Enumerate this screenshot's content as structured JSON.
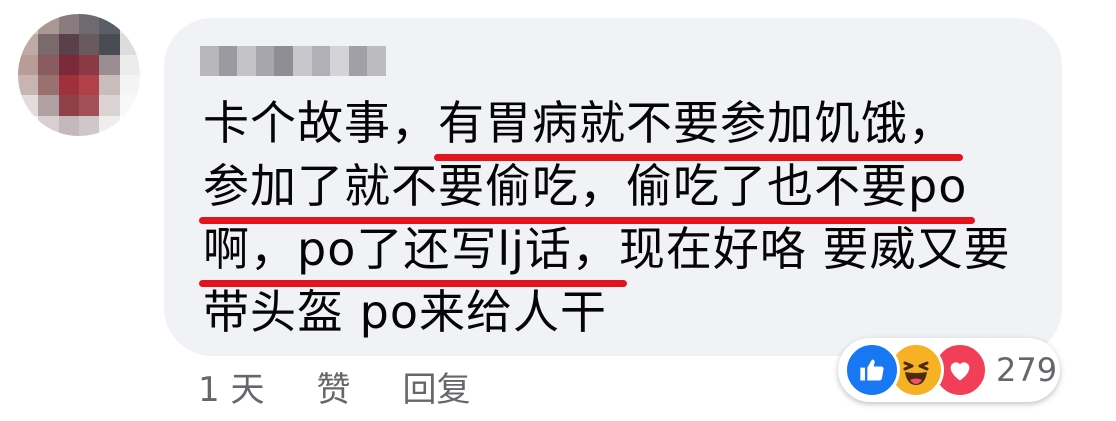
{
  "comment": {
    "author_name": "",
    "lines": [
      {
        "plain": "卡个故事，",
        "underlined": "有胃病就不要参加饥饿，"
      },
      {
        "plain": "",
        "underlined": "参加了就不要偷吃，偷吃了也不要po"
      },
      {
        "plain_after": "现在好咯 要威又要",
        "underlined": "啊，po了还写lj话，"
      },
      {
        "plain": "带头盔 po来给人干"
      }
    ]
  },
  "actions": {
    "time": "1 天",
    "like": "赞",
    "reply": "回复"
  },
  "reactions": {
    "icons": [
      "like-icon",
      "haha-icon",
      "love-icon"
    ],
    "count": "279"
  },
  "colors": {
    "bubble": "#f0f2f5",
    "underline": "#e3141e",
    "like": "#1877f2",
    "haha": "#f7b125",
    "love": "#f33e58"
  }
}
